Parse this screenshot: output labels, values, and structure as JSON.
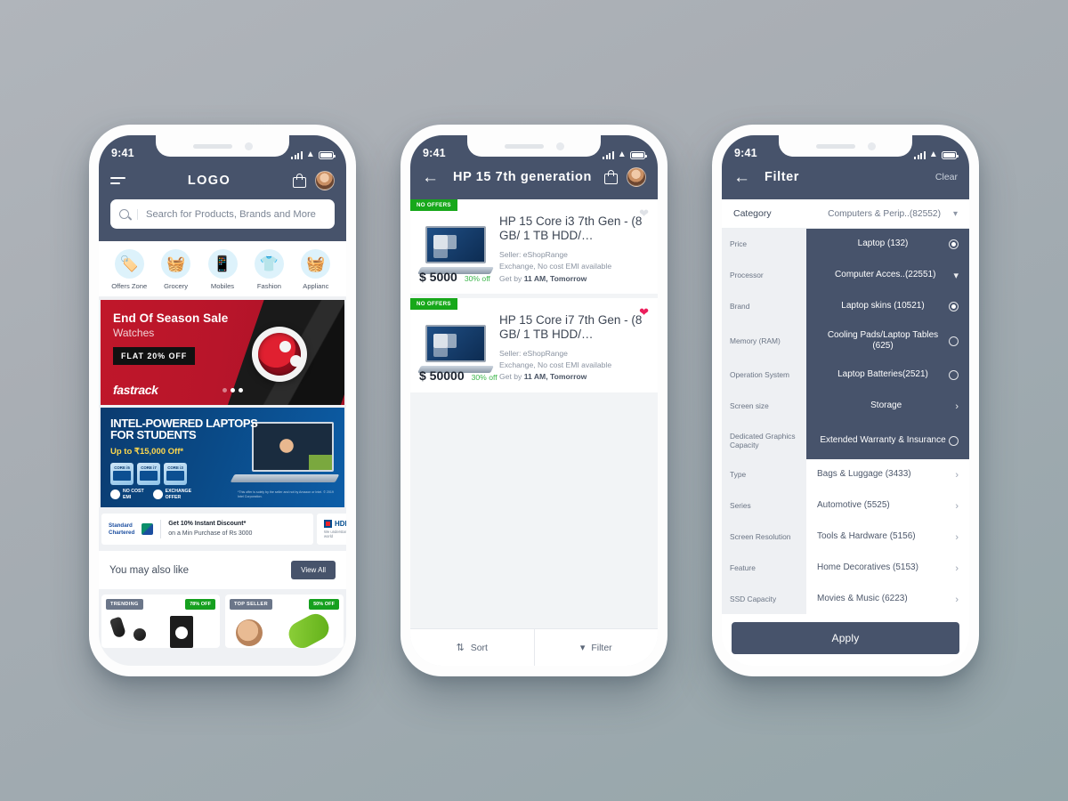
{
  "status_bar": {
    "time": "9:41"
  },
  "phone1": {
    "nav": {
      "title": "LOGO",
      "menu_icon": "hamburger-icon",
      "bag_icon": "shopping-bag-icon",
      "avatar": "user-avatar"
    },
    "search": {
      "placeholder": "Search for Products, Brands and More",
      "icon": "search-icon"
    },
    "categories": [
      {
        "label": "Offers Zone",
        "icon": "🏷️"
      },
      {
        "label": "Grocery",
        "icon": "🧺"
      },
      {
        "label": "Mobiles",
        "icon": "📱"
      },
      {
        "label": "Fashion",
        "icon": "👕"
      },
      {
        "label": "Applianc",
        "icon": "🧺"
      }
    ],
    "banner_watch": {
      "title": "End Of Season Sale",
      "subtitle": "Watches",
      "badge": "FLAT 20% OFF",
      "brand": "fastrack"
    },
    "banner_intel": {
      "title_line1": "INTEL-POWERED LAPTOPS",
      "title_line2": "FOR STUDENTS",
      "offer": "Up to ₹15,000 Off*",
      "chips": [
        "CORE i5",
        "CORE i7",
        "CORE i3"
      ],
      "feature1": "NO COST\nEMI",
      "feature2": "EXCHANGE\nOFFER",
      "disclaimer": "*This offer is solely by the seller and not by Amazon or Intel. © 2019 Intel Corporation."
    },
    "bank_offer": {
      "bank_name": "Standard\nChartered",
      "text_line1": "Get 10% Instant Discount*",
      "text_line2": "on a Min Purchase of Rs 3000",
      "bank2_name": "HDFC",
      "bank2_tagline": "We understand your world"
    },
    "you_may_also_like": {
      "title": "You may also like",
      "view_all": "View All",
      "products": [
        {
          "tag": "TRENDING",
          "discount": "78% OFF"
        },
        {
          "tag": "TOP SELLER",
          "discount": "50% OFF"
        }
      ]
    }
  },
  "phone2": {
    "nav": {
      "title": "HP 15 7th generation",
      "back_icon": "back-arrow-icon",
      "bag_icon": "shopping-bag-icon",
      "avatar": "user-avatar"
    },
    "products": [
      {
        "badge": "NO OFFERS",
        "name": "HP 15 Core i3 7th Gen - (8 GB/ 1 TB HDD/…",
        "seller": "Seller: eShopRange",
        "exchange": "Exchange, No cost EMI available",
        "delivery_prefix": "Get by ",
        "delivery": "11 AM, Tomorrow",
        "price": "$ 5000",
        "discount": "30% off",
        "wishlisted": false
      },
      {
        "badge": "NO OFFERS",
        "name": "HP 15 Core i7 7th Gen - (8 GB/ 1 TB HDD/…",
        "seller": "Seller: eShopRange",
        "exchange": "Exchange, No cost EMI available",
        "delivery_prefix": "Get by ",
        "delivery": "11 AM, Tomorrow",
        "price": "$ 50000",
        "discount": "30% off",
        "wishlisted": true
      }
    ],
    "bottom_bar": {
      "sort": "Sort",
      "filter": "Filter"
    }
  },
  "phone3": {
    "nav": {
      "title": "Filter",
      "back_icon": "back-arrow-icon",
      "clear": "Clear"
    },
    "category_row": {
      "key": "Category",
      "value": "Computers & Perip..(82552)",
      "chevron": "chevron-down-icon"
    },
    "left_facets": [
      "Price",
      "Processor",
      "Brand",
      "Memory (RAM)",
      "Operation System",
      "Screen size",
      "Dedicated Graphics Capacity",
      "Type",
      "Series",
      "Screen Resolution",
      "Feature",
      "SSD Capacity"
    ],
    "options": [
      {
        "label": "Laptop (132)",
        "selected": true,
        "control": "radio",
        "checked": true
      },
      {
        "label": "Computer Acces..(22551)",
        "selected": true,
        "control": "chevron-down"
      },
      {
        "label": "Laptop skins (10521)",
        "selected": true,
        "control": "radio",
        "checked": true
      },
      {
        "label": "Cooling Pads/Laptop Tables (625)",
        "selected": true,
        "control": "radio",
        "checked": false,
        "tall": true
      },
      {
        "label": "Laptop Batteries(2521)",
        "selected": true,
        "control": "radio",
        "checked": false
      },
      {
        "label": "Storage",
        "selected": true,
        "control": "chevron-right"
      },
      {
        "label": "Extended Warranty & Insurance",
        "selected": true,
        "control": "radio",
        "checked": false,
        "tall": true
      },
      {
        "label": "Bags & Luggage (3433)",
        "selected": false,
        "control": "chevron-right"
      },
      {
        "label": "Automotive (5525)",
        "selected": false,
        "control": "chevron-right"
      },
      {
        "label": "Tools & Hardware (5156)",
        "selected": false,
        "control": "chevron-right"
      },
      {
        "label": "Home Decoratives (5153)",
        "selected": false,
        "control": "chevron-right"
      },
      {
        "label": "Movies & Music (6223)",
        "selected": false,
        "control": "chevron-right"
      }
    ],
    "apply_button": "Apply"
  },
  "colors": {
    "header": "#47536b",
    "accent_green": "#17a81a",
    "heart_active": "#ec1e5c",
    "banner_red": "#b8152a",
    "banner_blue": "#0a4a87"
  }
}
